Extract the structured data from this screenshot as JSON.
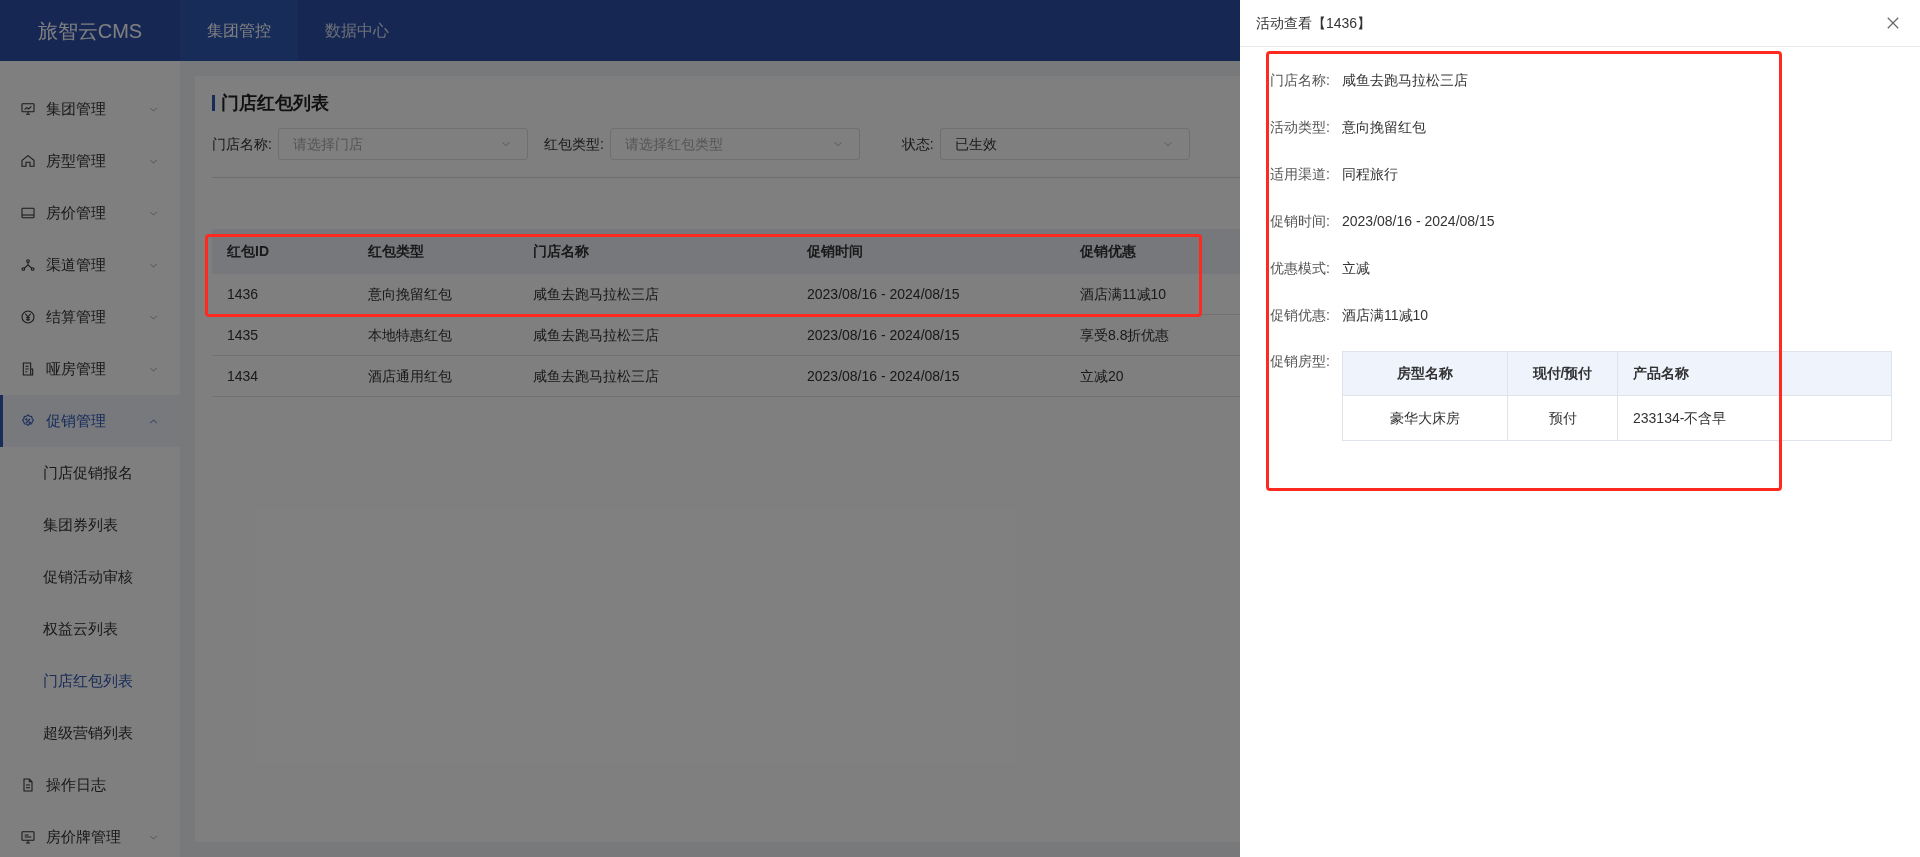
{
  "app": {
    "logo": "旅智云CMS"
  },
  "top_nav": [
    {
      "label": "集团管控",
      "selected": true
    },
    {
      "label": "数据中心",
      "selected": false
    }
  ],
  "sidebar": {
    "items": [
      {
        "label": "集团管理",
        "expanded": false
      },
      {
        "label": "房型管理",
        "expanded": false
      },
      {
        "label": "房价管理",
        "expanded": false
      },
      {
        "label": "渠道管理",
        "expanded": false
      },
      {
        "label": "结算管理",
        "expanded": false
      },
      {
        "label": "哑房管理",
        "expanded": false
      },
      {
        "label": "促销管理",
        "expanded": true,
        "children": [
          {
            "label": "门店促销报名",
            "selected": false
          },
          {
            "label": "集团券列表",
            "selected": false
          },
          {
            "label": "促销活动审核",
            "selected": false
          },
          {
            "label": "权益云列表",
            "selected": false
          },
          {
            "label": "门店红包列表",
            "selected": true
          },
          {
            "label": "超级营销列表",
            "selected": false
          }
        ]
      },
      {
        "label": "操作日志"
      },
      {
        "label": "房价牌管理",
        "expanded": false
      }
    ]
  },
  "page": {
    "title": "门店红包列表",
    "filters": [
      {
        "label": "门店名称:",
        "placeholder": "请选择门店"
      },
      {
        "label": "红包类型:",
        "placeholder": "请选择红包类型"
      },
      {
        "label": "状态:",
        "value": "已生效"
      }
    ],
    "table": {
      "columns": [
        "红包ID",
        "红包类型",
        "门店名称",
        "促销时间",
        "促销优惠"
      ],
      "rows": [
        [
          "1436",
          "意向挽留红包",
          "咸鱼去跑马拉松三店",
          "2023/08/16 - 2024/08/15",
          "酒店满11减10"
        ],
        [
          "1435",
          "本地特惠红包",
          "咸鱼去跑马拉松三店",
          "2023/08/16 - 2024/08/15",
          "享受8.8折优惠"
        ],
        [
          "1434",
          "酒店通用红包",
          "咸鱼去跑马拉松三店",
          "2023/08/16 - 2024/08/15",
          "立减20"
        ]
      ]
    }
  },
  "drawer": {
    "title": "活动查看【1436】",
    "fields": [
      {
        "label": "门店名称:",
        "value": "咸鱼去跑马拉松三店"
      },
      {
        "label": "活动类型:",
        "value": "意向挽留红包"
      },
      {
        "label": "适用渠道:",
        "value": "同程旅行"
      },
      {
        "label": "促销时间:",
        "value": "2023/08/16 - 2024/08/15"
      },
      {
        "label": "优惠模式:",
        "value": "立减"
      },
      {
        "label": "促销优惠:",
        "value": "酒店满11减10"
      }
    ],
    "room_types": {
      "label": "促销房型:",
      "columns": [
        "房型名称",
        "现付/预付",
        "产品名称"
      ],
      "rows": [
        [
          "豪华大床房",
          "预付",
          "233134-不含早"
        ]
      ]
    }
  }
}
